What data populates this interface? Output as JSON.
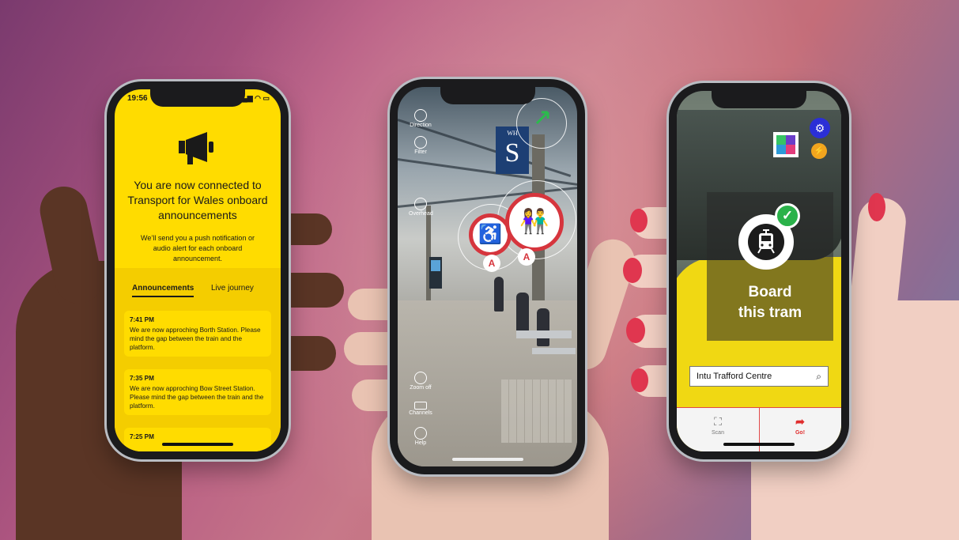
{
  "phone_left": {
    "status_time": "19:56",
    "status_icons": "▂▄▆ ◠ ▭",
    "headline": "You are now connected to Transport for Wales onboard announcements",
    "subtext": "We’ll send you a push notification or audio alert for each onboard announcement.",
    "tabs": [
      {
        "label": "Announcements",
        "active": true
      },
      {
        "label": "Live journey",
        "active": false
      }
    ],
    "announcements": [
      {
        "time": "7:41 PM",
        "text": "We are now approching Borth Station. Please mind the gap between the train and the platform."
      },
      {
        "time": "7:35 PM",
        "text": "We are now approching Bow Street Station. Please mind the gap between the train and the platform."
      },
      {
        "time": "7:25 PM",
        "text": ""
      }
    ],
    "accent_color": "#ffdc00"
  },
  "phone_middle": {
    "sign_text": "S",
    "sign_small": "WH",
    "side_tools": [
      "Direction",
      "Filter",
      "Overhead",
      "Zoom off",
      "Channels",
      "Help"
    ],
    "badges": [
      "accessible-toilet-icon",
      "toilets-icon"
    ],
    "pins": [
      "A",
      "A"
    ],
    "badge_color": "#d6353d"
  },
  "phone_right": {
    "status_text": "Board\nthis tram",
    "status_line1": "Board",
    "status_line2": "this tram",
    "search_value": "Intu Trafford Centre",
    "bottom_nav": [
      {
        "label": "Scan",
        "icon": "scan-icon"
      },
      {
        "label": "Go!",
        "icon": "directions-icon"
      }
    ],
    "accent_color": "#e02d2d",
    "check_color": "#2ab24a"
  }
}
